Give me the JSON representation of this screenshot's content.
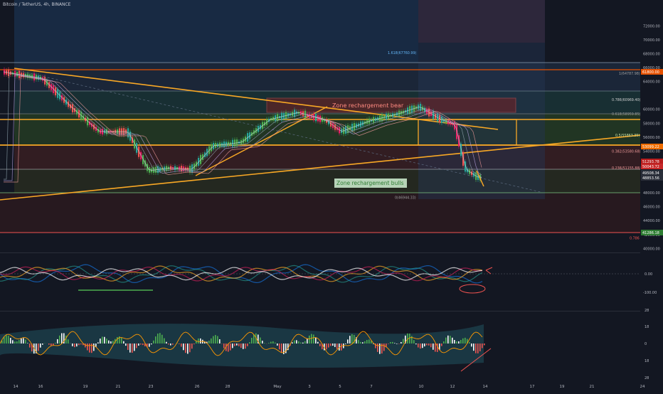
{
  "header": {
    "symbol": "Bitcoin / TetherUS, 4h, BINANCE"
  },
  "chart_data": {
    "type": "line",
    "title": "Bitcoin / TetherUS, 4h, BINANCE",
    "x_tick_labels": [
      "14",
      "16",
      "19",
      "21",
      "23",
      "26",
      "28",
      "May",
      "3",
      "5",
      "7",
      "10",
      "12",
      "14",
      "17",
      "19",
      "21",
      "24"
    ],
    "price_axis": {
      "ticks": [
        "72000.00",
        "70000.00",
        "68000.00",
        "66000.00",
        "64000.00",
        "60000.00",
        "58000.00",
        "56000.00",
        "54000.00",
        "52000.00",
        "50000.00",
        "48000.00",
        "46000.00",
        "44000.00",
        "42000.00",
        "40000.00"
      ],
      "ylim": [
        38800,
        73500
      ]
    },
    "price_tags": [
      {
        "text": "61800.00",
        "color": "#e65100"
      },
      {
        "text": "53099.22",
        "color": "#ef6c00"
      },
      {
        "text": "51293.78",
        "color": "#b71c1c"
      },
      {
        "text": "50043.72",
        "color": "#c62828"
      },
      {
        "text": "49508.34",
        "color": "#2a2e39"
      },
      {
        "text": "48853.56",
        "color": "#2a2e39"
      },
      {
        "text": "41286.18",
        "color": "#2e7d32"
      }
    ],
    "fib_labels": [
      {
        "text": "1.618(67760.99)",
        "price": 67760.99,
        "color": "#64b5f6"
      },
      {
        "text": "1(64787.98)",
        "price": 64787.98,
        "color": "#9e9e9e"
      },
      {
        "text": "0.786(60969.40)",
        "price": 60969.4,
        "color": "#d0d0d0"
      },
      {
        "text": "0.618(58959.85)",
        "price": 58959.85,
        "color": "#9e9e9e"
      },
      {
        "text": "0.5(55863.35)",
        "price": 55863.35,
        "color": "#c5e1a5"
      },
      {
        "text": "0.382(53580.68)",
        "price": 53580.68,
        "color": "#ef9a9a"
      },
      {
        "text": "0.236(51155.88)",
        "price": 51155.88,
        "color": "#ef9a9a"
      },
      {
        "text": "0(46944.33)",
        "price": 46944.33,
        "color": "#9e9e9e"
      },
      {
        "text": "0.786",
        "price": 41100,
        "color": "#ef5350"
      }
    ],
    "annotations": [
      "Zone rechargement bear",
      "Zone rechargement bulls"
    ],
    "osc1": {
      "ticks": [
        "0.00",
        "-100.00"
      ]
    },
    "osc2": {
      "ticks": [
        "28",
        "18",
        "0",
        "18",
        "28"
      ]
    },
    "colors": {
      "bull": "#26a69a",
      "bear": "#ef5350",
      "trendline": "#f9a825",
      "background": "#131722"
    }
  }
}
